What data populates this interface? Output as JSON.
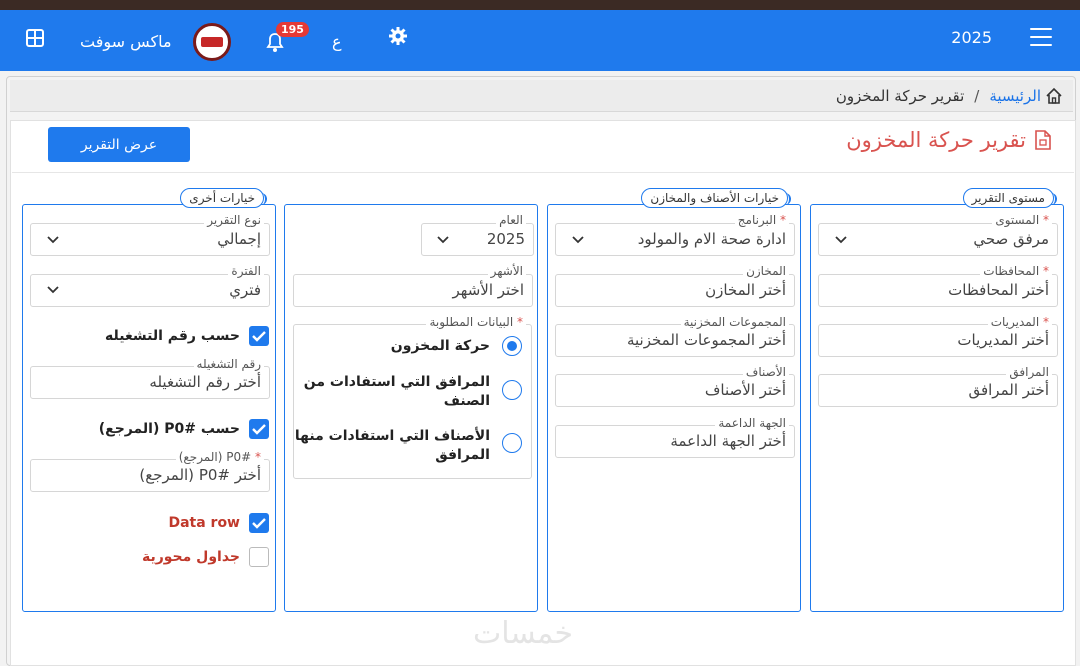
{
  "navbar": {
    "year": "2025",
    "language_toggle": "ع",
    "notification_count": "195",
    "user_name": "ماكس سوفت",
    "colors": {
      "bar": "#1f7aed",
      "badge": "#e53935"
    }
  },
  "breadcrumb": {
    "home": "الرئيسية",
    "separator": "/",
    "current": "تقرير حركة المخزون"
  },
  "page": {
    "title": "تقرير حركة المخزون",
    "show_report_button": "عرض التقرير"
  },
  "panels": {
    "report_level": {
      "legend": "مستوى التقرير",
      "level": {
        "label": "المستوى",
        "value": "مرفق صحي"
      },
      "governorates": {
        "label": "المحافظات",
        "placeholder": "أختر المحافظات"
      },
      "directorates": {
        "label": "المديريات",
        "placeholder": "أختر المديريات"
      },
      "facilities": {
        "label": "المرافق",
        "placeholder": "أختر المرافق"
      }
    },
    "items_stores": {
      "legend": "خيارات الأصناف والمخازن",
      "program": {
        "label": "البرنامج",
        "value": "ادارة صحة الام والمولود"
      },
      "stores": {
        "label": "المخازن",
        "placeholder": "أختر المخازن"
      },
      "store_groups": {
        "label": "المجموعات المخزنية",
        "placeholder": "أختر المجموعات المخزنية"
      },
      "items": {
        "label": "الأصناف",
        "placeholder": "أختر الأصناف"
      },
      "supporting_entity": {
        "label": "الجهة الداعمة",
        "placeholder": "أختر الجهة الداعمة"
      }
    },
    "period": {
      "year": {
        "label": "العام",
        "value": "2025"
      },
      "months": {
        "label": "الأشهر",
        "placeholder": "اختر الأشهر"
      },
      "required_data": {
        "label": "البيانات المطلوبة",
        "options": [
          {
            "line1": "حركة المخزون",
            "line2": "",
            "selected": true
          },
          {
            "line1": "المرافق التي استفادات من",
            "line2": "الصنف",
            "selected": false
          },
          {
            "line1": "الأصناف التي استفادات منها",
            "line2": "المرافق",
            "selected": false
          }
        ]
      }
    },
    "other_options": {
      "legend": "خيارات أخرى",
      "report_type": {
        "label": "نوع التقرير",
        "value": "إجمالي"
      },
      "period": {
        "label": "الفترة",
        "value": "فتري"
      },
      "by_batch": {
        "label": "حسب رقم التشغيله",
        "checked": true
      },
      "batch_number": {
        "label": "رقم التشغيله",
        "placeholder": "أختر رقم التشغيله"
      },
      "by_po": {
        "label": "حسب P0# (المرجع)",
        "checked": true
      },
      "po_field": {
        "label": "P0# (المرجع)",
        "placeholder": "أختر P0# (المرجع)"
      },
      "data_row": {
        "label": "Data row",
        "checked": true
      },
      "pivot_tables": {
        "label": "جداول محورية",
        "checked": false
      }
    }
  },
  "watermark": "خمسات"
}
